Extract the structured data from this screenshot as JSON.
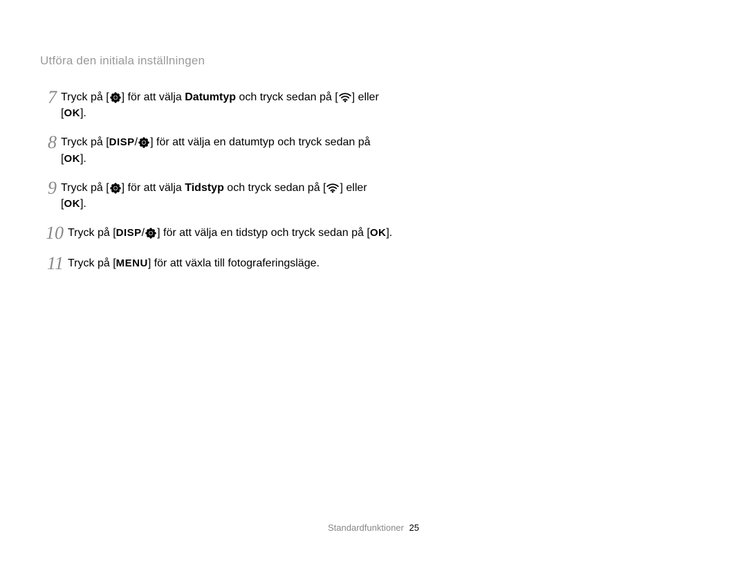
{
  "header": {
    "title": "Utföra den initiala inställningen"
  },
  "steps": [
    {
      "num": "7",
      "segments": [
        {
          "type": "text",
          "value": "Tryck på ["
        },
        {
          "type": "icon",
          "value": "flower"
        },
        {
          "type": "text",
          "value": "] för att välja "
        },
        {
          "type": "bold",
          "value": "Datumtyp"
        },
        {
          "type": "text",
          "value": " och tryck sedan på ["
        },
        {
          "type": "icon",
          "value": "wifi"
        },
        {
          "type": "text",
          "value": "] eller ["
        },
        {
          "type": "label",
          "value": "OK"
        },
        {
          "type": "text",
          "value": "]."
        }
      ]
    },
    {
      "num": "8",
      "segments": [
        {
          "type": "text",
          "value": "Tryck på ["
        },
        {
          "type": "label",
          "value": "DISP"
        },
        {
          "type": "text",
          "value": "/"
        },
        {
          "type": "icon",
          "value": "flower"
        },
        {
          "type": "text",
          "value": "] för att välja en datumtyp och tryck sedan på ["
        },
        {
          "type": "label",
          "value": "OK"
        },
        {
          "type": "text",
          "value": "]."
        }
      ]
    },
    {
      "num": "9",
      "segments": [
        {
          "type": "text",
          "value": "Tryck på ["
        },
        {
          "type": "icon",
          "value": "flower"
        },
        {
          "type": "text",
          "value": "] för att välja "
        },
        {
          "type": "bold",
          "value": "Tidstyp"
        },
        {
          "type": "text",
          "value": " och tryck sedan på ["
        },
        {
          "type": "icon",
          "value": "wifi"
        },
        {
          "type": "text",
          "value": "] eller ["
        },
        {
          "type": "label",
          "value": "OK"
        },
        {
          "type": "text",
          "value": "]."
        }
      ]
    },
    {
      "num": "10",
      "segments": [
        {
          "type": "text",
          "value": "Tryck på ["
        },
        {
          "type": "label",
          "value": "DISP"
        },
        {
          "type": "text",
          "value": "/"
        },
        {
          "type": "icon",
          "value": "flower"
        },
        {
          "type": "text",
          "value": "] för att välja en tidstyp och tryck sedan på ["
        },
        {
          "type": "label",
          "value": "OK"
        },
        {
          "type": "text",
          "value": "]."
        }
      ]
    },
    {
      "num": "11",
      "segments": [
        {
          "type": "text",
          "value": "Tryck på ["
        },
        {
          "type": "label",
          "value": "MENU"
        },
        {
          "type": "text",
          "value": "] för att växla till fotograferingsläge."
        }
      ]
    }
  ],
  "footer": {
    "section": "Standardfunktioner",
    "page": "25"
  }
}
